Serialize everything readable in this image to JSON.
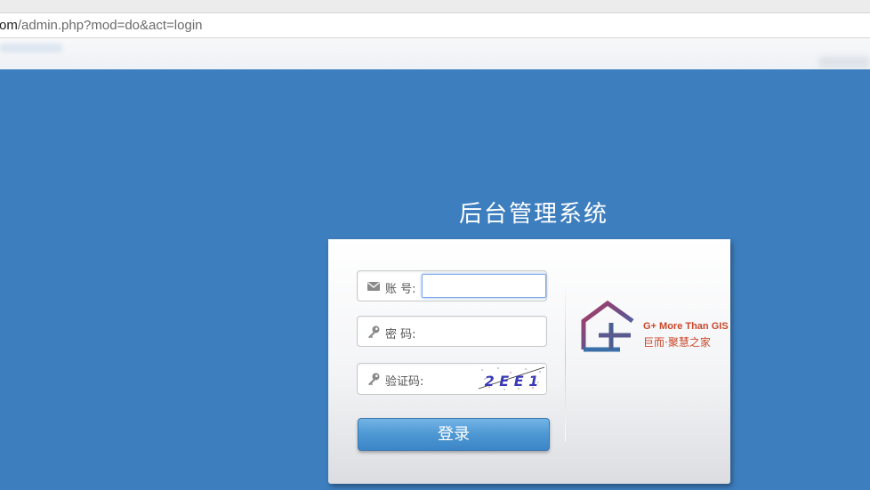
{
  "browser": {
    "url_domain_tail": "om",
    "url_path": "/admin.php?mod=do&act=login"
  },
  "page": {
    "title": "后台管理系统"
  },
  "form": {
    "account_label": "账 号:",
    "account_value": "",
    "password_label": "密 码:",
    "password_value": "",
    "captcha_label": "验证码:",
    "captcha_value": "",
    "captcha_image_text": "2 E E 1",
    "login_button_label": "登录"
  },
  "logo": {
    "english_text": "G+ More Than GIS",
    "chinese_text": "巨而·聚慧之家"
  },
  "colors": {
    "page_background": "#3d7ebe",
    "button_blue": "#4d97d3",
    "logo_red": "#c9482b",
    "logo_blue": "#3f5f8f"
  }
}
